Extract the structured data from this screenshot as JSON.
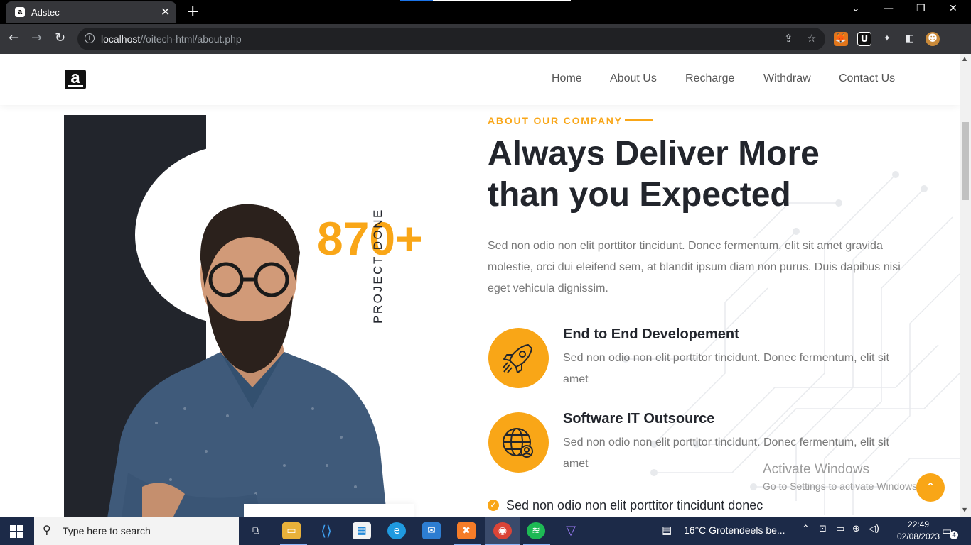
{
  "browser": {
    "tab_title": "Adstec",
    "tab_favicon": "a",
    "url_host": "localhost",
    "url_path": "//oitech-html/about.php",
    "icons": {
      "close": "✕",
      "new_tab": "+",
      "back": "←",
      "forward": "→",
      "reload": "↻",
      "minimize": "—",
      "maximize": "❐",
      "win_close": "✕",
      "tabs_dropdown": "⌄",
      "share": "⇪",
      "bookmark": "☆",
      "info": "i"
    }
  },
  "site": {
    "logo": "a",
    "nav": [
      "Home",
      "About Us",
      "Recharge",
      "Withdraw",
      "Contact Us"
    ]
  },
  "about": {
    "counter": "870+",
    "counter_label": "PROJECT DONE",
    "eyebrow": "ABOUT OUR COMPANY",
    "heading_line1": "Always Deliver More",
    "heading_line2": "than you Expected",
    "lead": "Sed non odio non elit porttitor tincidunt. Donec fermentum, elit sit amet gravida molestie, orci dui eleifend sem, at blandit ipsum diam non purus. Duis dapibus nisi eget vehicula dignissim.",
    "features": [
      {
        "title": "End to End Developement",
        "text": "Sed non odio non elit porttitor tincidunt. Donec fermentum, elit sit amet",
        "icon": "rocket-icon"
      },
      {
        "title": "Software IT Outsource",
        "text": "Sed non odio non elit porttitor tincidunt. Donec fermentum, elit sit amet",
        "icon": "globe-user-icon"
      }
    ],
    "checklist_item": "Sed non odio non elit porttitor tincidunt donec"
  },
  "watermark": {
    "line1": "Activate Windows",
    "line2": "Go to Settings to activate Windows."
  },
  "scroll_top": "⌃",
  "taskbar": {
    "search_placeholder": "Type here to search",
    "weather": "16°C  Grotendeels be...",
    "time": "22:49",
    "date": "02/08/2023",
    "notification_count": "4"
  },
  "colors": {
    "accent": "#f9a617",
    "dark": "#22252c",
    "text_muted": "#777777"
  }
}
